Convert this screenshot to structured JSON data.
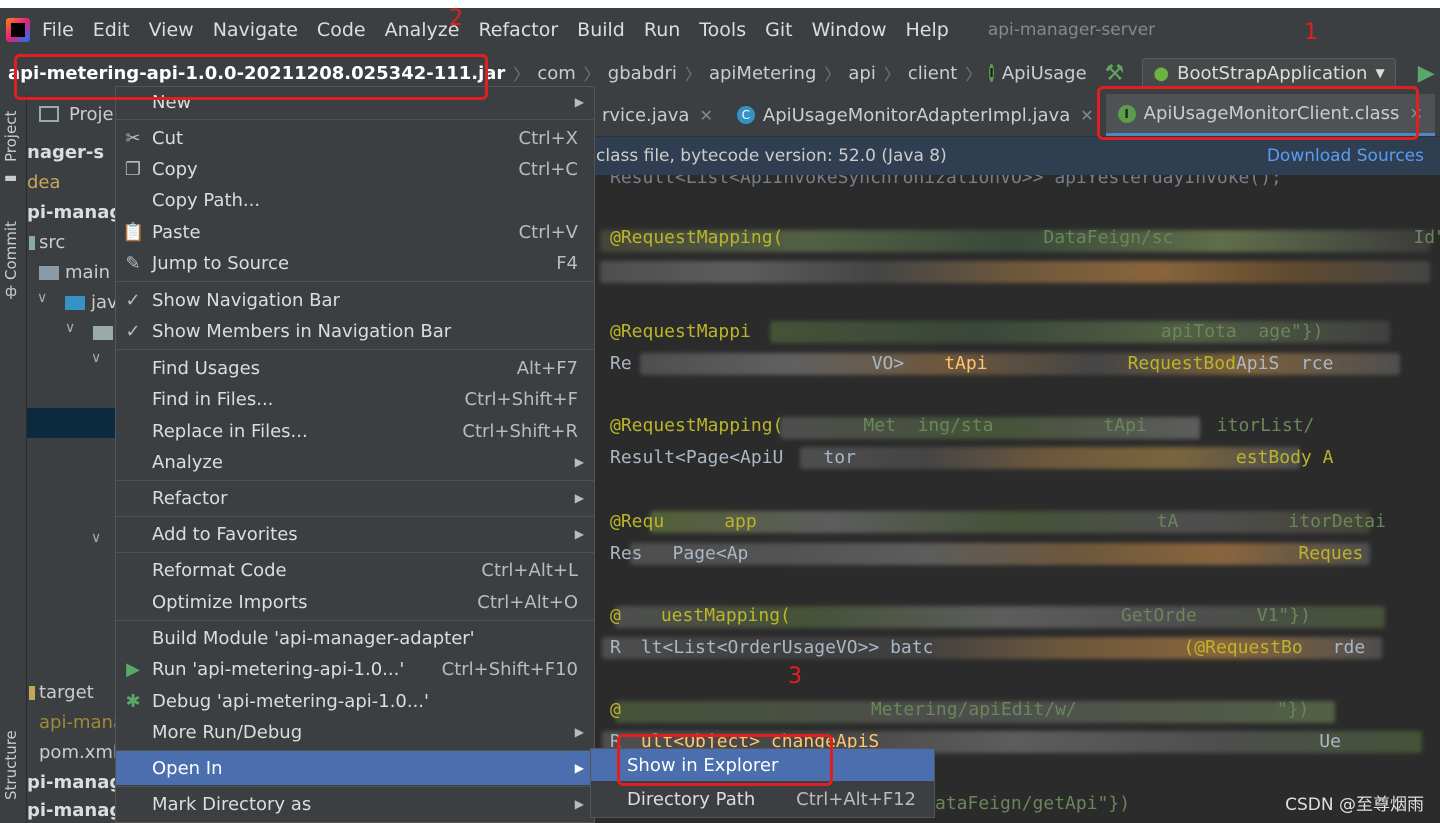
{
  "menubar": {
    "items": [
      "File",
      "Edit",
      "View",
      "Navigate",
      "Code",
      "Analyze",
      "Refactor",
      "Build",
      "Run",
      "Tools",
      "Git",
      "Window",
      "Help"
    ],
    "project_title": "api-manager-server"
  },
  "navbar": {
    "breadcrumbs": [
      "api-metering-api-1.0.0-20211208.025342-111.jar",
      "com",
      "gbabdri",
      "apiMetering",
      "api",
      "client",
      "ApiUsage"
    ],
    "run_config": "BootStrapApplication"
  },
  "left_strip": {
    "project": "Project",
    "commit": "Commit",
    "structure": "Structure"
  },
  "project_panel": {
    "header": "Proje",
    "rows": [
      "nager-s",
      "dea",
      "pi-manag",
      "src",
      "main",
      "jav",
      "target",
      "api-mana",
      "pom.xml",
      "pi-manage",
      "pi-manag"
    ]
  },
  "tabs": [
    {
      "label": "rvice.java"
    },
    {
      "label": "ApiUsageMonitorAdapterImpl.java"
    },
    {
      "label": "ApiUsageMonitorClient.class"
    }
  ],
  "banner": {
    "message": "class file, bytecode version: 52.0 (Java 8)",
    "link": "Download Sources"
  },
  "code_lines": {
    "l1": "Result<List<ApiInvokeSynchronizationVO>> apiYesterdayInvoke();",
    "l2a": "@RequestMapping(",
    "l2b": "DataFeign/sc",
    "l2c": "Id\"})",
    "l3": "@RequestMappi",
    "l3b": "apiTota  age\"})",
    "l4a": "Re",
    "l4b": "VO>",
    "l4c": "tApi",
    "l4d": "RequestBod",
    "l4e": "ApiS  rce",
    "l5a": "@RequestMapping(",
    "l5b": "Met  ing/sta",
    "l5c": "tApi",
    "l5d": "itorList/",
    "l6a": "Result<Page<ApiU",
    "l6b": "tor",
    "l6c": "estBody A",
    "l7a": "@Requ",
    "l7b": "app",
    "l7c": "tA",
    "l7d": "itorDetai",
    "l8a": "Res",
    "l8b": "Page<Ap",
    "l8c": "Reques",
    "l9a": "@",
    "l9b": "uestMapping(",
    "l9c": "GetOrde",
    "l9d": "V1\"})",
    "l10a": "R",
    "l10b": "lt<List<OrderUsageVO>> batc",
    "l10c": "(@RequestBo",
    "l10d": "rde",
    "l11a": "@",
    "l11b": "Metering/apiEdit/w/",
    "l11c": "\"})",
    "l12a": "R",
    "l12b": "ult<Object> changeApiS",
    "l12c": "Ue",
    "l13": "ataFeign/getApi\"})"
  },
  "context_menu": {
    "items": [
      {
        "label": "New",
        "shortcut": "",
        "submenu": true,
        "icon": ""
      },
      {
        "label": "Cut",
        "shortcut": "Ctrl+X",
        "icon": "cut-icon"
      },
      {
        "label": "Copy",
        "shortcut": "Ctrl+C",
        "icon": "copy-icon"
      },
      {
        "label": "Copy Path...",
        "shortcut": "",
        "icon": ""
      },
      {
        "label": "Paste",
        "shortcut": "Ctrl+V",
        "icon": "paste-icon"
      },
      {
        "label": "Jump to Source",
        "shortcut": "F4",
        "icon": "edit-icon"
      },
      {
        "label": "Show Navigation Bar",
        "shortcut": "",
        "icon": "check-icon"
      },
      {
        "label": "Show Members in Navigation Bar",
        "shortcut": "",
        "icon": "check-icon"
      },
      {
        "label": "Find Usages",
        "shortcut": "Alt+F7",
        "icon": ""
      },
      {
        "label": "Find in Files...",
        "shortcut": "Ctrl+Shift+F",
        "icon": ""
      },
      {
        "label": "Replace in Files...",
        "shortcut": "Ctrl+Shift+R",
        "icon": ""
      },
      {
        "label": "Analyze",
        "shortcut": "",
        "submenu": true,
        "icon": ""
      },
      {
        "label": "Refactor",
        "shortcut": "",
        "submenu": true,
        "icon": ""
      },
      {
        "label": "Add to Favorites",
        "shortcut": "",
        "submenu": true,
        "icon": ""
      },
      {
        "label": "Reformat Code",
        "shortcut": "Ctrl+Alt+L",
        "icon": ""
      },
      {
        "label": "Optimize Imports",
        "shortcut": "Ctrl+Alt+O",
        "icon": ""
      },
      {
        "label": "Build Module 'api-manager-adapter'",
        "shortcut": "",
        "icon": ""
      },
      {
        "label": "Run 'api-metering-api-1.0...'",
        "shortcut": "Ctrl+Shift+F10",
        "icon": "run-icon"
      },
      {
        "label": "Debug 'api-metering-api-1.0...'",
        "shortcut": "",
        "icon": "debug-icon"
      },
      {
        "label": "More Run/Debug",
        "shortcut": "",
        "submenu": true,
        "icon": ""
      },
      {
        "label": "Open In",
        "shortcut": "",
        "submenu": true,
        "icon": ""
      },
      {
        "label": "Mark Directory as",
        "shortcut": "",
        "submenu": true,
        "icon": ""
      }
    ]
  },
  "submenu": {
    "items": [
      {
        "label": "Show in Explorer",
        "shortcut": ""
      },
      {
        "label": "Directory Path",
        "shortcut": "Ctrl+Alt+F12"
      }
    ]
  },
  "annotations": {
    "n1": "1",
    "n2": "2",
    "n3": "3"
  },
  "watermark": "CSDN @至尊烟雨",
  "colors": {
    "highlight": "#4b6eaf",
    "annotation_red": "#e02020",
    "link": "#589df6"
  }
}
